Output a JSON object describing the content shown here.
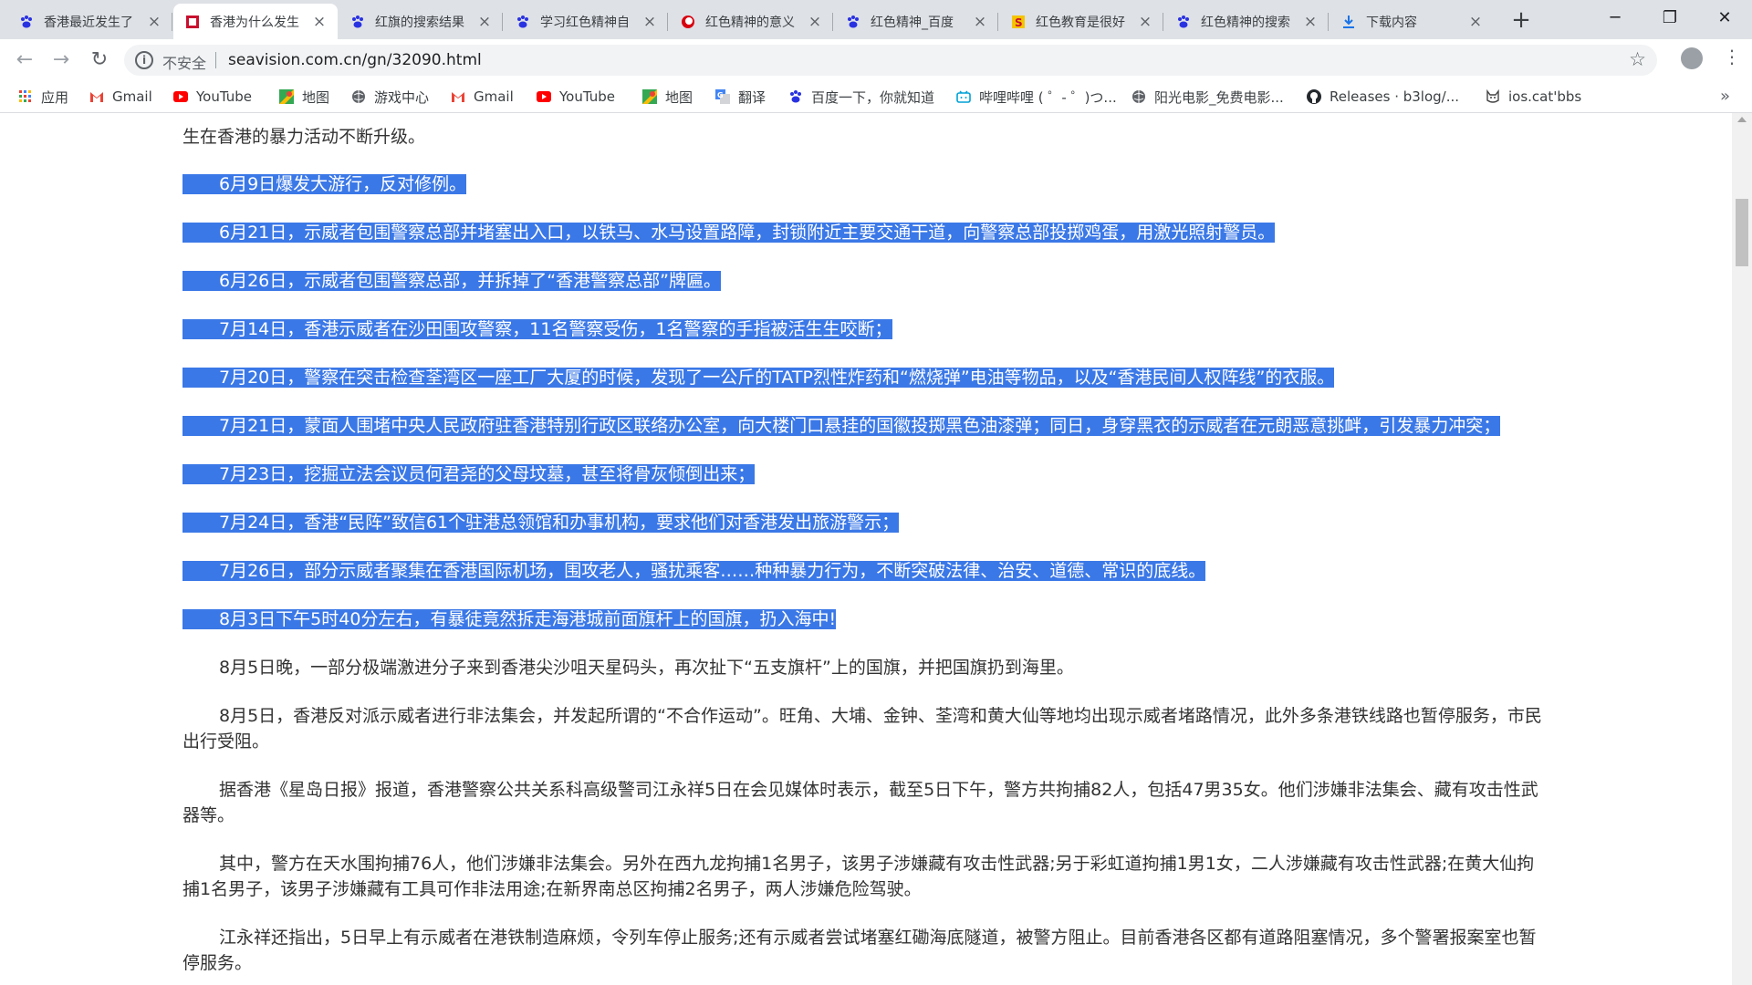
{
  "tabs": [
    {
      "title": "香港最近发生了",
      "icon": "baidu-paw-icon",
      "active": false
    },
    {
      "title": "香港为什么发生",
      "icon": "red-page-icon",
      "active": true
    },
    {
      "title": "红旗的搜索结果",
      "icon": "baidu-paw-icon",
      "active": false
    },
    {
      "title": "学习红色精神自",
      "icon": "baidu-paw-icon",
      "active": false
    },
    {
      "title": "红色精神的意义",
      "icon": "red-circle-icon",
      "active": false
    },
    {
      "title": "红色精神_百度",
      "icon": "baidu-paw-icon",
      "active": false
    },
    {
      "title": "红色教育是很好",
      "icon": "yellow-s-icon",
      "active": false
    },
    {
      "title": "红色精神的搜索",
      "icon": "baidu-paw-icon",
      "active": false
    },
    {
      "title": "下载内容",
      "icon": "download-icon",
      "active": false
    }
  ],
  "window_controls": {
    "minimize": "─",
    "maximize": "❐",
    "close": "✕"
  },
  "toolbar": {
    "security_label": "不安全",
    "url": "seavision.com.cn/gn/32090.html"
  },
  "bookmarks": [
    {
      "label": "应用",
      "icon": "apps-grid-icon"
    },
    {
      "label": "Gmail",
      "icon": "gmail-icon"
    },
    {
      "label": "YouTube",
      "icon": "youtube-icon"
    },
    {
      "label": "地图",
      "icon": "maps-icon"
    },
    {
      "label": "游戏中心",
      "icon": "globe-icon"
    },
    {
      "label": "Gmail",
      "icon": "gmail-icon"
    },
    {
      "label": "YouTube",
      "icon": "youtube-icon"
    },
    {
      "label": "地图",
      "icon": "maps-icon"
    },
    {
      "label": "翻译",
      "icon": "translate-icon"
    },
    {
      "label": "百度一下，你就知道",
      "icon": "baidu-paw-icon"
    },
    {
      "label": "哔哩哔哩 ( ゜- ゜)つ...",
      "icon": "bilibili-icon"
    },
    {
      "label": "阳光电影_免费电影...",
      "icon": "globe-icon"
    },
    {
      "label": "Releases · b3log/...",
      "icon": "github-icon"
    },
    {
      "label": "ios.cat'bbs",
      "icon": "cat-icon"
    }
  ],
  "article": {
    "paragraphs": [
      {
        "text": "生在香港的暴力活动不断升级。",
        "highlight": false,
        "indent": false
      },
      {
        "text": "6月9日爆发大游行，反对修例。",
        "highlight": true,
        "indent": true
      },
      {
        "text": "6月21日，示威者包围警察总部并堵塞出入口，以铁马、水马设置路障，封锁附近主要交通干道，向警察总部投掷鸡蛋，用激光照射警员。",
        "highlight": true,
        "indent": true
      },
      {
        "text": "6月26日，示威者包围警察总部，并拆掉了“香港警察总部”牌匾。",
        "highlight": true,
        "indent": true
      },
      {
        "text": "7月14日，香港示威者在沙田围攻警察，11名警察受伤，1名警察的手指被活生生咬断；",
        "highlight": true,
        "indent": true
      },
      {
        "text": "7月20日，警察在突击检查荃湾区一座工厂大厦的时候，发现了一公斤的TATP烈性炸药和“燃烧弹”电油等物品，以及“香港民间人权阵线”的衣服。",
        "highlight": true,
        "indent": true
      },
      {
        "text": "7月21日，蒙面人围堵中央人民政府驻香港特别行政区联络办公室，向大楼门口悬挂的国徽投掷黑色油漆弹；同日，身穿黑衣的示威者在元朗恶意挑衅，引发暴力冲突；",
        "highlight": true,
        "indent": true
      },
      {
        "text": "7月23日，挖掘立法会议员何君尧的父母坟墓，甚至将骨灰倾倒出来；",
        "highlight": true,
        "indent": true
      },
      {
        "text": "7月24日，香港“民阵”致信61个驻港总领馆和办事机构，要求他们对香港发出旅游警示；",
        "highlight": true,
        "indent": true
      },
      {
        "text": "7月26日，部分示威者聚集在香港国际机场，围攻老人，骚扰乘客……种种暴力行为，不断突破法律、治安、道德、常识的底线。",
        "highlight": true,
        "indent": true
      },
      {
        "text": "8月3日下午5时40分左右，有暴徒竟然拆走海港城前面旗杆上的国旗，扔入海中!",
        "highlight": true,
        "indent": true
      },
      {
        "text": "8月5日晚，一部分极端激进分子来到香港尖沙咀天星码头，再次扯下“五支旗杆”上的国旗，并把国旗扔到海里。",
        "highlight": false,
        "indent": true
      },
      {
        "text": "8月5日，香港反对派示威者进行非法集会，并发起所谓的“不合作运动”。旺角、大埔、金钟、荃湾和黄大仙等地均出现示威者堵路情况，此外多条港铁线路也暂停服务，市民出行受阻。",
        "highlight": false,
        "indent": true
      },
      {
        "text": "据香港《星岛日报》报道，香港警察公共关系科高级警司江永祥5日在会见媒体时表示，截至5日下午，警方共拘捕82人，包括47男35女。他们涉嫌非法集会、藏有攻击性武器等。",
        "highlight": false,
        "indent": true
      },
      {
        "text": "其中，警方在天水围拘捕76人，他们涉嫌非法集会。另外在西九龙拘捕1名男子，该男子涉嫌藏有攻击性武器;另于彩虹道拘捕1男1女，二人涉嫌藏有攻击性武器;在黄大仙拘捕1名男子，该男子涉嫌藏有工具可作非法用途;在新界南总区拘捕2名男子，两人涉嫌危险驾驶。",
        "highlight": false,
        "indent": true
      },
      {
        "text": "江永祥还指出，5日早上有示威者在港铁制造麻烦，令列车停止服务;还有示威者尝试堵塞红磡海底隧道，被警方阻止。目前香港各区都有道路阻塞情况，多个警署报案室也暂停服务。",
        "highlight": false,
        "indent": true
      }
    ]
  }
}
